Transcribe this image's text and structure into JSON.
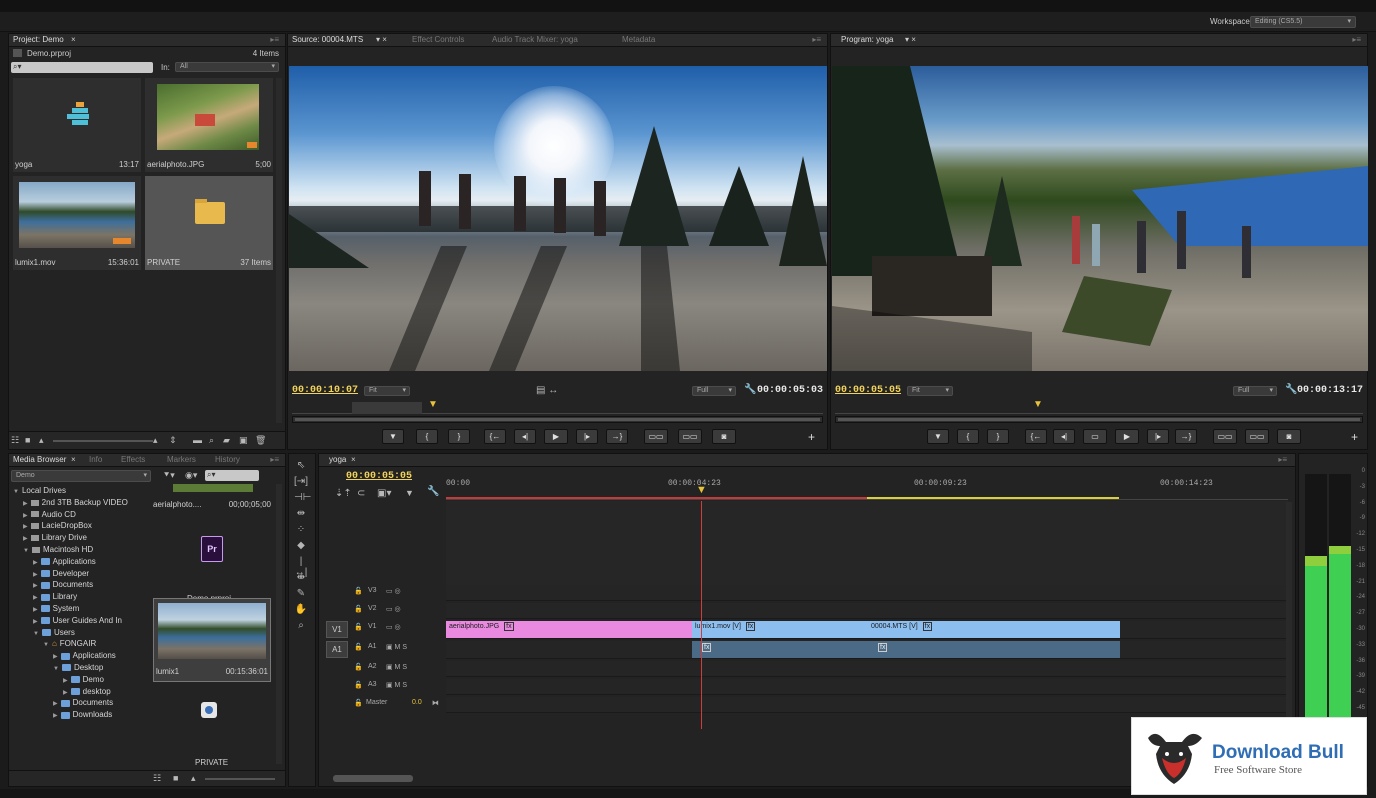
{
  "workspace": {
    "label": "Workspace:",
    "value": "Editing (CS5.5)"
  },
  "project": {
    "tab": "Project: Demo",
    "file": "Demo.prproj",
    "count": "4 Items",
    "in_label": "In:",
    "in_value": "All",
    "items": [
      {
        "name": "yoga",
        "duration": "13:17"
      },
      {
        "name": "aerialphoto.JPG",
        "duration": "5;00"
      },
      {
        "name": "lumix1.mov",
        "duration": "15:36:01"
      },
      {
        "name": "PRIVATE",
        "duration": "37 Items"
      }
    ]
  },
  "source": {
    "tabs": [
      "Source: 00004.MTS",
      "Effect Controls",
      "Audio Track Mixer: yoga",
      "Metadata"
    ],
    "timecode": "00:00:10:07",
    "fit": "Fit",
    "full": "Full",
    "duration": "00:00:05:03"
  },
  "program": {
    "tab": "Program: yoga",
    "timecode": "00:00:05:05",
    "fit": "Fit",
    "full": "Full",
    "duration": "00:00:13:17"
  },
  "media_browser": {
    "tabs": [
      "Media Browser",
      "Info",
      "Effects",
      "Markers",
      "History"
    ],
    "location": "Demo",
    "tree": [
      {
        "label": "Local Drives",
        "level": 0,
        "type": "root"
      },
      {
        "label": "2nd 3TB Backup VIDEO",
        "level": 1,
        "type": "drive"
      },
      {
        "label": "Audio CD",
        "level": 1,
        "type": "drive"
      },
      {
        "label": "LacieDropBox",
        "level": 1,
        "type": "drive"
      },
      {
        "label": "Library Drive",
        "level": 1,
        "type": "drive"
      },
      {
        "label": "Macintosh HD",
        "level": 1,
        "type": "drive"
      },
      {
        "label": "Applications",
        "level": 2,
        "type": "folder"
      },
      {
        "label": "Developer",
        "level": 2,
        "type": "folder"
      },
      {
        "label": "Documents",
        "level": 2,
        "type": "folder"
      },
      {
        "label": "Library",
        "level": 2,
        "type": "folder"
      },
      {
        "label": "System",
        "level": 2,
        "type": "folder"
      },
      {
        "label": "User Guides And In",
        "level": 2,
        "type": "folder"
      },
      {
        "label": "Users",
        "level": 2,
        "type": "folder"
      },
      {
        "label": "FONGAIR",
        "level": 3,
        "type": "home"
      },
      {
        "label": "Applications",
        "level": 4,
        "type": "folder"
      },
      {
        "label": "Desktop",
        "level": 4,
        "type": "folder"
      },
      {
        "label": "Demo",
        "level": 5,
        "type": "folder"
      },
      {
        "label": "desktop",
        "level": 5,
        "type": "folder"
      },
      {
        "label": "Documents",
        "level": 4,
        "type": "folder"
      },
      {
        "label": "Downloads",
        "level": 4,
        "type": "folder"
      }
    ],
    "files": [
      {
        "name": "aerialphoto....",
        "duration": "00;00;05;00"
      },
      {
        "name": "Demo.prproj",
        "duration": ""
      },
      {
        "name": "lumix1",
        "duration": "00:15:36:01"
      },
      {
        "name": "PRIVATE",
        "duration": ""
      }
    ]
  },
  "timeline": {
    "tab": "yoga",
    "timecode": "00:00:05:05",
    "ruler": [
      "00:00",
      "00:00:04:23",
      "00:00:09:23",
      "00:00:14:23"
    ],
    "tracks": [
      {
        "id": "V3",
        "icons": "▭ ◎"
      },
      {
        "id": "V2",
        "icons": "▭ ◎"
      },
      {
        "id": "V1",
        "icons": "▭ ◎",
        "src": "V1"
      },
      {
        "id": "A1",
        "icons": "▣ M S",
        "src": "A1"
      },
      {
        "id": "A2",
        "icons": "▣ M S"
      },
      {
        "id": "A3",
        "icons": "▣ M S"
      }
    ],
    "master": {
      "label": "Master",
      "value": "0.0"
    },
    "clips": [
      {
        "name": "aerialphoto.JPG",
        "color": "#e98ae0"
      },
      {
        "name": "lumix1.mov [V]",
        "color": "#8dbef0"
      },
      {
        "name": "00004.MTS [V]",
        "color": "#8dbef0"
      }
    ]
  },
  "meter": {
    "ticks": [
      "0",
      "-3",
      "-6",
      "-9",
      "-12",
      "-15",
      "-18",
      "-21",
      "-24",
      "-27",
      "-30",
      "-33",
      "-36",
      "-39",
      "-42",
      "-45",
      "-48"
    ]
  },
  "watermark": {
    "title": "Download Bull",
    "subtitle": "Free Software Store"
  }
}
